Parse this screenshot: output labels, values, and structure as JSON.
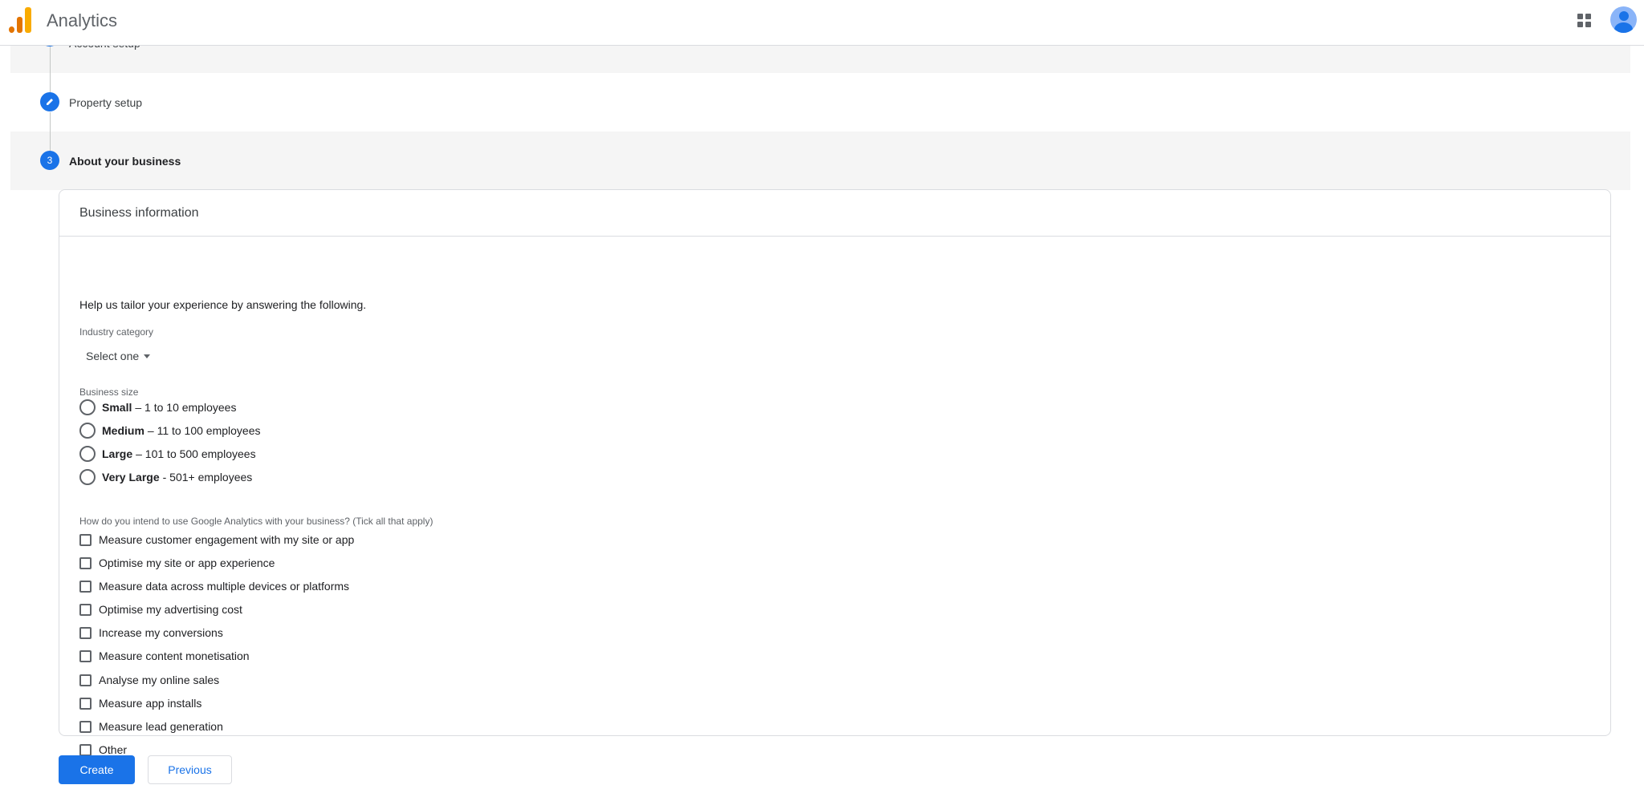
{
  "app": {
    "title": "Analytics"
  },
  "steps": [
    {
      "label": "Account setup",
      "number": ""
    },
    {
      "label": "Property setup",
      "number": ""
    },
    {
      "label": "About your business",
      "number": "3"
    }
  ],
  "card": {
    "title": "Business information",
    "intro": "Help us tailor your experience by answering the following.",
    "industry": {
      "label": "Industry category",
      "value": "Select one"
    },
    "size": {
      "label": "Business size",
      "options": [
        {
          "bold": "Small",
          "rest": "– 1 to 10 employees"
        },
        {
          "bold": "Medium",
          "rest": "– 11 to 100 employees"
        },
        {
          "bold": "Large",
          "rest": "– 101 to 500 employees"
        },
        {
          "bold": "Very Large",
          "rest": "- 501+ employees"
        }
      ]
    },
    "usage": {
      "label": "How do you intend to use Google Analytics with your business? (Tick all that apply)",
      "options": [
        "Measure customer engagement with my site or app",
        "Optimise my site or app experience",
        "Measure data across multiple devices or platforms",
        "Optimise my advertising cost",
        "Increase my conversions",
        "Measure content monetisation",
        "Analyse my online sales",
        "Measure app installs",
        "Measure lead generation",
        "Other"
      ]
    }
  },
  "buttons": {
    "create": "Create",
    "previous": "Previous"
  },
  "colors": {
    "accent": "#1a73e8",
    "logo_orange": "#e37400",
    "logo_yellow": "#f9ab00"
  },
  "icons": {
    "apps": "apps-grid-icon",
    "avatar": "account-avatar-icon",
    "edit": "pencil-icon"
  }
}
